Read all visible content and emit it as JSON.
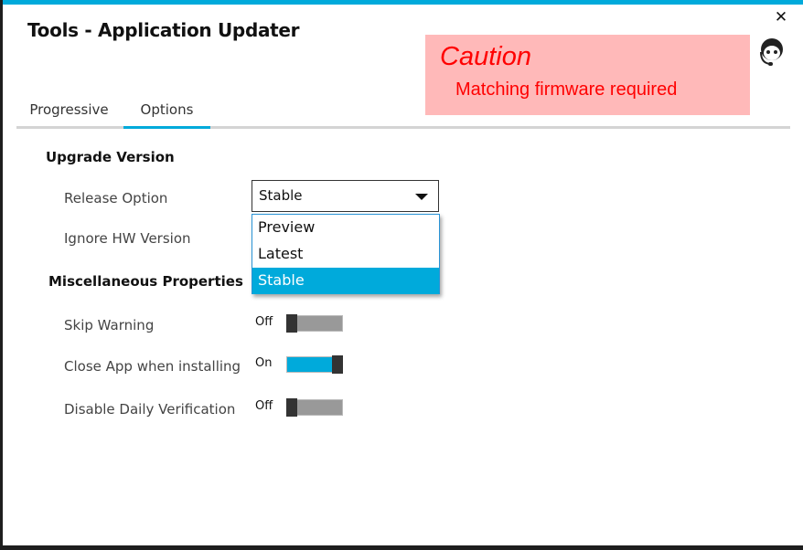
{
  "window": {
    "title": "Tools - Application Updater",
    "close_label": "✕",
    "accent_color": "#00aadb"
  },
  "caution": {
    "title": "Caution",
    "message": "Matching firmware required",
    "background_color": "#ffb9b9",
    "text_color": "#ff0000"
  },
  "tabs": [
    {
      "label": "Progressive",
      "active": false
    },
    {
      "label": "Options",
      "active": true
    }
  ],
  "upgrade_version": {
    "title": "Upgrade Version",
    "release_option": {
      "label": "Release Option",
      "value": "Stable",
      "options": [
        "Preview",
        "Latest",
        "Stable"
      ],
      "selected": "Stable",
      "expanded": true
    },
    "ignore_hw_version": {
      "label": "Ignore HW Version"
    }
  },
  "misc": {
    "title": "Miscellaneous Properties",
    "toggles": [
      {
        "label": "Skip Warning",
        "state": "Off",
        "on": false
      },
      {
        "label": "Close App when installing",
        "state": "On",
        "on": true
      },
      {
        "label": "Disable Daily Verification",
        "state": "Off",
        "on": false
      }
    ]
  },
  "icons": {
    "close": "close-icon",
    "support": "headset-support-icon",
    "dropdown": "chevron-down-icon"
  }
}
